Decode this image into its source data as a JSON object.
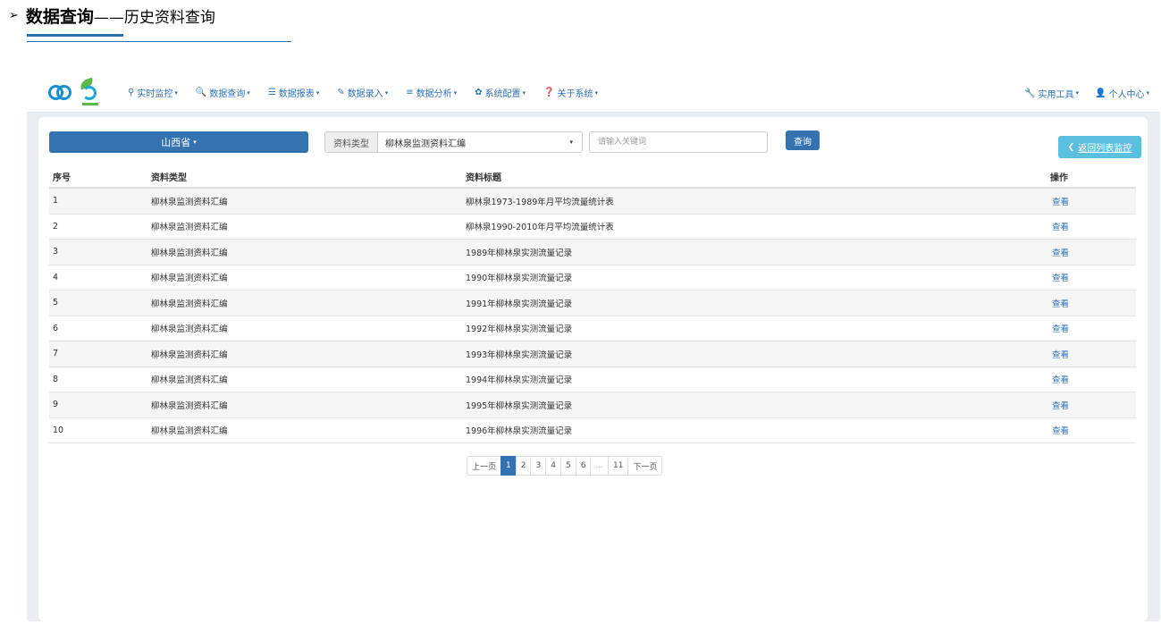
{
  "heading": {
    "arrow": "➢",
    "strong": "数据查询",
    "sub": "——历史资料查询"
  },
  "nav": {
    "items": [
      {
        "icon": "map-marker-icon",
        "glyph": "⚲",
        "label": "实时监控"
      },
      {
        "icon": "search-icon",
        "glyph": "🔍",
        "label": "数据查询"
      },
      {
        "icon": "list-icon",
        "glyph": "☰",
        "label": "数据报表"
      },
      {
        "icon": "edit-icon",
        "glyph": "✎",
        "label": "数据录入"
      },
      {
        "icon": "tasks-icon",
        "glyph": "≡",
        "label": "数据分析"
      },
      {
        "icon": "gear-icon",
        "glyph": "✿",
        "label": "系统配置"
      },
      {
        "icon": "question-icon",
        "glyph": "❓",
        "label": "关于系统"
      }
    ],
    "right": [
      {
        "icon": "wrench-icon",
        "glyph": "🔧",
        "label": "实用工具"
      },
      {
        "icon": "user-icon",
        "glyph": "👤",
        "label": "个人中心"
      }
    ],
    "caret": "▾"
  },
  "filters": {
    "province": "山西省",
    "type_label": "资料类型",
    "type_value": "柳林泉监测资料汇编",
    "keyword_placeholder": "请输入关键词",
    "query_label": "查询",
    "back_label": "返回列表监控",
    "back_glyph": "❮"
  },
  "table": {
    "headers": [
      "序号",
      "资料类型",
      "资料标题",
      "操作"
    ],
    "rows": [
      {
        "no": "1",
        "type": "柳林泉监测资料汇编",
        "title": "柳林泉1973-1989年月平均流量统计表",
        "action": "查看"
      },
      {
        "no": "2",
        "type": "柳林泉监测资料汇编",
        "title": "柳林泉1990-2010年月平均流量统计表",
        "action": "查看"
      },
      {
        "no": "3",
        "type": "柳林泉监测资料汇编",
        "title": "1989年柳林泉实测流量记录",
        "action": "查看"
      },
      {
        "no": "4",
        "type": "柳林泉监测资料汇编",
        "title": "1990年柳林泉实测流量记录",
        "action": "查看"
      },
      {
        "no": "5",
        "type": "柳林泉监测资料汇编",
        "title": "1991年柳林泉实测流量记录",
        "action": "查看"
      },
      {
        "no": "6",
        "type": "柳林泉监测资料汇编",
        "title": "1992年柳林泉实测流量记录",
        "action": "查看"
      },
      {
        "no": "7",
        "type": "柳林泉监测资料汇编",
        "title": "1993年柳林泉实测流量记录",
        "action": "查看"
      },
      {
        "no": "8",
        "type": "柳林泉监测资料汇编",
        "title": "1994年柳林泉实测流量记录",
        "action": "查看"
      },
      {
        "no": "9",
        "type": "柳林泉监测资料汇编",
        "title": "1995年柳林泉实测流量记录",
        "action": "查看"
      },
      {
        "no": "10",
        "type": "柳林泉监测资料汇编",
        "title": "1996年柳林泉实测流量记录",
        "action": "查看"
      }
    ]
  },
  "pagination": {
    "prev": "上一页",
    "pages": [
      "1",
      "2",
      "3",
      "4",
      "5",
      "6",
      "...",
      "11"
    ],
    "active": "1",
    "next": "下一页"
  },
  "colors": {
    "primary": "#3572b0",
    "info": "#5bc0de",
    "link": "#2e72b7",
    "frame": "#e9eef3"
  }
}
